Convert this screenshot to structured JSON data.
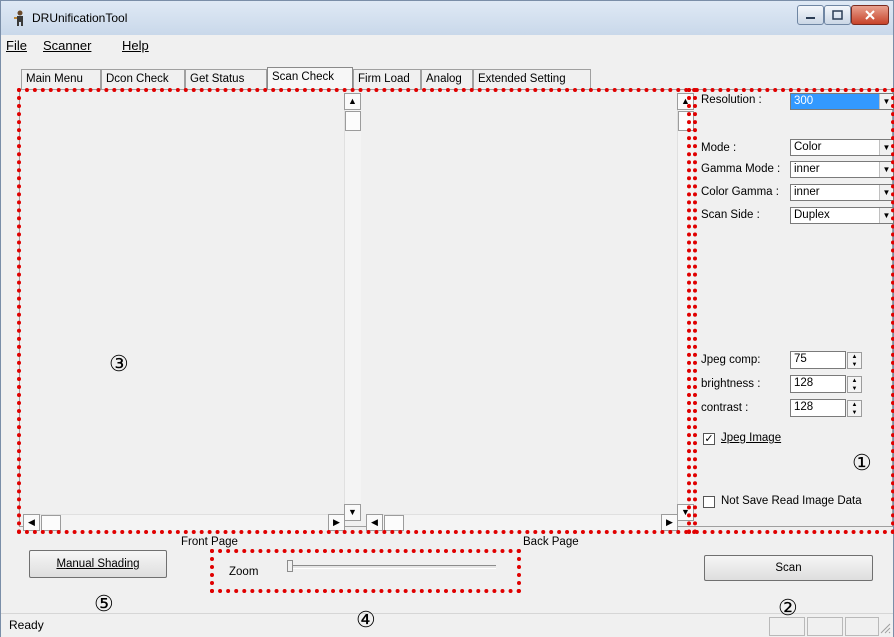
{
  "window": {
    "title": "DRUnificationTool"
  },
  "menu": [
    "File",
    "Scanner",
    "Help"
  ],
  "tabs": [
    "Main Menu",
    "Dcon Check",
    "Get Status",
    "Scan Check",
    "Firm Load",
    "Analog",
    "Extended Setting"
  ],
  "active_tab": "Scan Check",
  "settings": {
    "resolution": {
      "label": "Resolution :",
      "value": "300"
    },
    "mode": {
      "label": "Mode :",
      "value": "Color"
    },
    "gamma_mode": {
      "label": "Gamma Mode :",
      "value": "inner"
    },
    "color_gamma": {
      "label": "Color Gamma :",
      "value": "inner"
    },
    "scan_side": {
      "label": "Scan Side :",
      "value": "Duplex"
    },
    "jpeg_comp": {
      "label": "Jpeg comp:",
      "value": "75"
    },
    "brightness": {
      "label": "brightness :",
      "value": "128"
    },
    "contrast": {
      "label": "contrast :",
      "value": "128"
    },
    "jpeg_image": {
      "label": "Jpeg Image",
      "checked": true
    },
    "not_save": {
      "label": "Not Save Read Image Data",
      "checked": false
    }
  },
  "pages": {
    "front": "Front Page",
    "back": "Back Page"
  },
  "buttons": {
    "manual_shading": "Manual Shading",
    "scan": "Scan"
  },
  "zoom": {
    "label": "Zoom",
    "level": 0
  },
  "callouts": [
    "①",
    "②",
    "③",
    "④",
    "⑤"
  ],
  "status": {
    "text": "Ready"
  },
  "colors": {
    "annotation": "#e00000",
    "selection": "#3399ff"
  }
}
